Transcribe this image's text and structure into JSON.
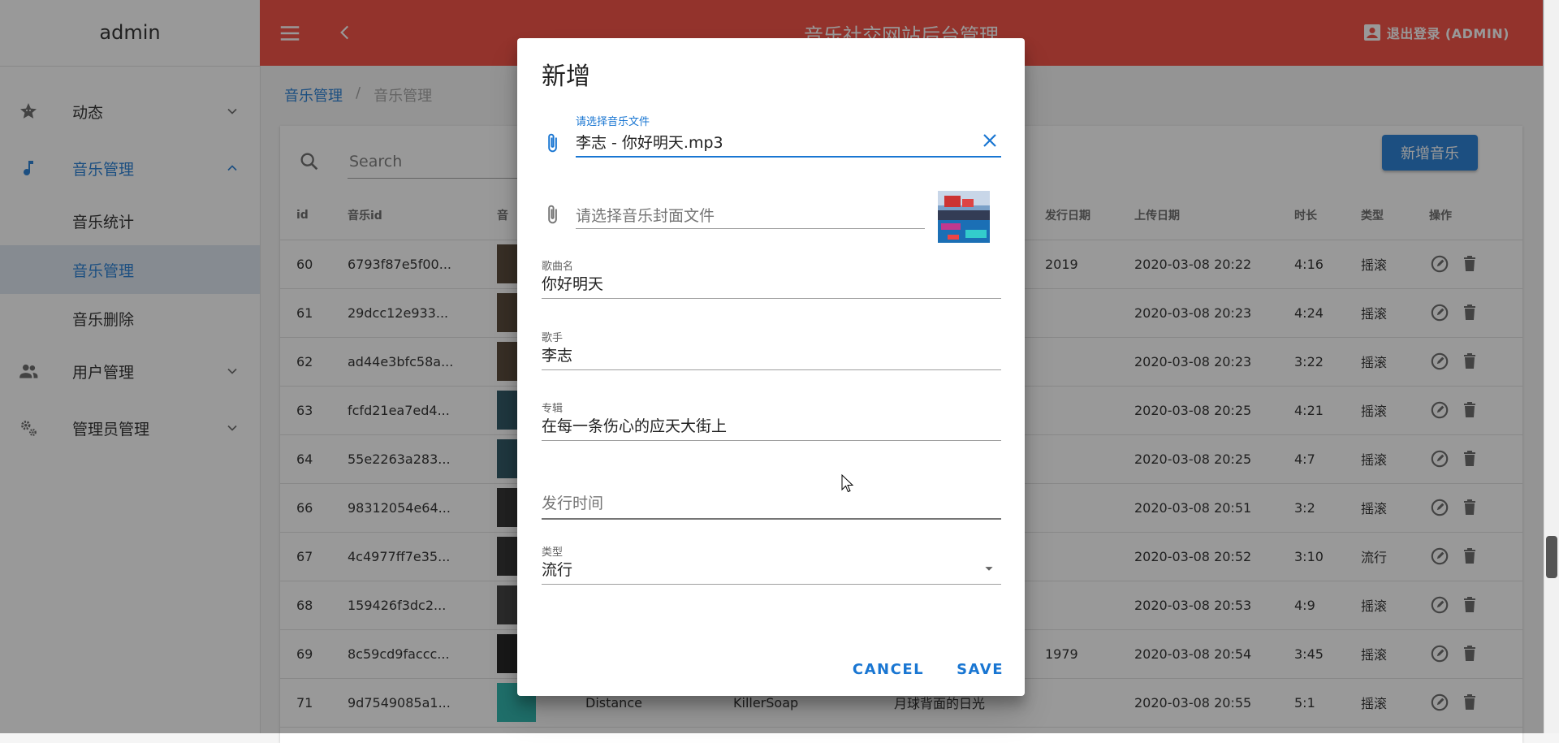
{
  "sidebar": {
    "brand": "admin",
    "items": [
      {
        "label": "动态",
        "icon": "star-face-icon"
      },
      {
        "label": "音乐管理",
        "icon": "music-note-icon",
        "children": [
          {
            "label": "音乐统计"
          },
          {
            "label": "音乐管理"
          },
          {
            "label": "音乐删除"
          }
        ]
      },
      {
        "label": "用户管理",
        "icon": "users-icon"
      },
      {
        "label": "管理员管理",
        "icon": "settings-cogs-icon"
      }
    ]
  },
  "header": {
    "title": "音乐社交网站后台管理",
    "logout": "退出登录 (ADMIN)",
    "bg_color": "#f44336"
  },
  "breadcrumb": {
    "parent": "音乐管理",
    "sep": "/",
    "current": "音乐管理"
  },
  "toolbar": {
    "search_placeholder": "Search",
    "add_label": "新增音乐"
  },
  "table": {
    "columns": [
      "id",
      "音乐id",
      "音",
      "",
      "",
      "",
      "发行日期",
      "上传日期",
      "时长",
      "类型",
      "操作"
    ],
    "rows": [
      {
        "id": "60",
        "music_id": "6793f87e5f00...",
        "song": "",
        "singer": "",
        "album": "",
        "release": "2019",
        "upload": "2020-03-08 20:22",
        "duration": "4:16",
        "type": "摇滚",
        "cover_color": "#4a3a2a"
      },
      {
        "id": "61",
        "music_id": "29dcc12e933...",
        "song": "",
        "singer": "",
        "album": "",
        "release": "",
        "upload": "2020-03-08 20:23",
        "duration": "4:24",
        "type": "摇滚",
        "cover_color": "#4a3a2a"
      },
      {
        "id": "62",
        "music_id": "ad44e3bfc58a...",
        "song": "",
        "singer": "",
        "album": "",
        "release": "",
        "upload": "2020-03-08 20:23",
        "duration": "3:22",
        "type": "摇滚",
        "cover_color": "#4a3a2a"
      },
      {
        "id": "63",
        "music_id": "fcfd21ea7ed4...",
        "song": "",
        "singer": "",
        "album": "",
        "release": "",
        "upload": "2020-03-08 20:25",
        "duration": "4:21",
        "type": "摇滚",
        "cover_color": "#1e4a5a"
      },
      {
        "id": "64",
        "music_id": "55e2263a283...",
        "song": "",
        "singer": "",
        "album": "",
        "release": "",
        "upload": "2020-03-08 20:25",
        "duration": "4:7",
        "type": "摇滚",
        "cover_color": "#1e4a5a"
      },
      {
        "id": "66",
        "music_id": "98312054e64...",
        "song": "",
        "singer": "",
        "album": "",
        "release": "",
        "upload": "2020-03-08 20:51",
        "duration": "3:2",
        "type": "摇滚",
        "cover_color": "#222222"
      },
      {
        "id": "67",
        "music_id": "4c4977ff7e35...",
        "song": "",
        "singer": "",
        "album": "",
        "release": "",
        "upload": "2020-03-08 20:52",
        "duration": "3:10",
        "type": "流行",
        "cover_color": "#222222"
      },
      {
        "id": "68",
        "music_id": "159426f3dc2...",
        "song": "",
        "singer": "",
        "album": "",
        "release": "",
        "upload": "2020-03-08 20:53",
        "duration": "4:9",
        "type": "摇滚",
        "cover_color": "#333333"
      },
      {
        "id": "69",
        "music_id": "8c59cd9faccc...",
        "song": "",
        "singer": "",
        "album": "",
        "release": "1979",
        "upload": "2020-03-08 20:54",
        "duration": "3:45",
        "type": "摇滚",
        "cover_color": "#111111"
      },
      {
        "id": "71",
        "music_id": "9d7549085a1...",
        "song": "Distance",
        "singer": "KillerSoap",
        "album": "月球背面的日光",
        "release": "",
        "upload": "2020-03-08 20:55",
        "duration": "5:1",
        "type": "摇滚",
        "cover_color": "#1fb1a8"
      }
    ]
  },
  "dialog": {
    "title": "新增",
    "music_file": {
      "label": "请选择音乐文件",
      "value": "李志 - 你好明天.mp3"
    },
    "cover_file": {
      "placeholder": "请选择音乐封面文件"
    },
    "song_name": {
      "label": "歌曲名",
      "value": "你好明天"
    },
    "singer": {
      "label": "歌手",
      "value": "李志"
    },
    "album": {
      "label": "专辑",
      "value": "在每一条伤心的应天大街上"
    },
    "release_time": {
      "placeholder": "发行时间"
    },
    "type": {
      "label": "类型",
      "value": "流行"
    },
    "cancel": "CANCEL",
    "save": "SAVE"
  },
  "colors": {
    "primary": "#1976d2",
    "header": "#f44336"
  }
}
